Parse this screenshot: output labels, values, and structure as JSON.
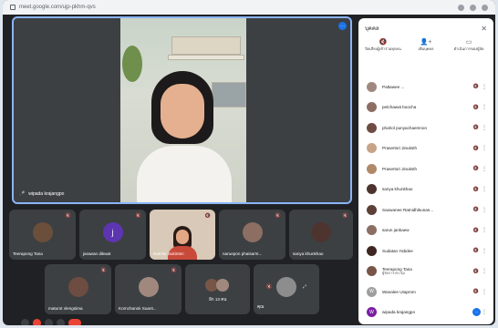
{
  "browser": {
    "url": "meet.google.com/ujp-pkhm-qvs"
  },
  "spotlight": {
    "name": "wipada krajangpo",
    "badge": "⋯"
  },
  "tiles": [
    {
      "name": "Teerapong Tana",
      "initial": "",
      "color": "#6b4f3a"
    },
    {
      "name": "jarawan dikwat",
      "initial": "j",
      "color": "#5e35b1"
    },
    {
      "name": "Natcha Sukinten",
      "initial": "",
      "color": "#c47b5a"
    },
    {
      "name": "naruepon phaisarnt...",
      "initial": "",
      "color": "#8d6e63"
    },
    {
      "name": "sanya khunkhao",
      "initial": "",
      "color": "#4e342e"
    },
    {
      "name": "maturot vlengsima",
      "initial": "",
      "color": "#6d4c41"
    },
    {
      "name": "Kornchanok Suant...",
      "initial": "",
      "color": "#a1887f"
    },
    {
      "name": "อีก 13 คน",
      "initial": "",
      "color": "#795548"
    },
    {
      "name": "คุณ",
      "initial": "",
      "color": "#8d8d8d"
    }
  ],
  "panel": {
    "title": "บุคคล",
    "actions": [
      {
        "icon": "🔇",
        "label": "ปิดเสียงผู้เข้าร่วมทุกคน"
      },
      {
        "icon": "👤+",
        "label": "เพิ่มบุคคล"
      },
      {
        "icon": "▭",
        "label": "ดำเนินการของผู้จัด"
      }
    ],
    "people": [
      {
        "name": "Pattawee ...",
        "sub": "",
        "color": "#a1887f",
        "initial": ""
      },
      {
        "name": "petchawat boocha",
        "sub": "",
        "color": "#8d6e63",
        "initial": ""
      },
      {
        "name": "phahol punyachaemnon",
        "sub": "",
        "color": "#6d4c41",
        "initial": ""
      },
      {
        "name": "Prasertori Jinuksth",
        "sub": "",
        "color": "#c7a488",
        "initial": ""
      },
      {
        "name": "Prasertori Jinuksth",
        "sub": "",
        "color": "#b08968",
        "initial": ""
      },
      {
        "name": "sanya khunkhao",
        "sub": "",
        "color": "#4e342e",
        "initial": ""
      },
      {
        "name": "Saowanee Ratnidhikunan...",
        "sub": "",
        "color": "#5d4037",
        "initial": ""
      },
      {
        "name": "sarun jankaew",
        "sub": "",
        "color": "#8d6e63",
        "initial": ""
      },
      {
        "name": "Sudatan Yabdee",
        "sub": "",
        "color": "#3e2723",
        "initial": ""
      },
      {
        "name": "Teerapong Tana",
        "sub": "ผู้จัดการประชุม",
        "color": "#795548",
        "initial": ""
      },
      {
        "name": "Wanalee Utaprom",
        "sub": "",
        "color": "#9e9e9e",
        "initial": "W"
      },
      {
        "name": "wipada krajangpo",
        "sub": "",
        "color": "#7b1fa2",
        "initial": "W"
      }
    ]
  },
  "colors": {
    "bg": "#202124",
    "tile": "#3c4043",
    "accent": "#1a73e8",
    "highlight": "#8ab4f8"
  }
}
